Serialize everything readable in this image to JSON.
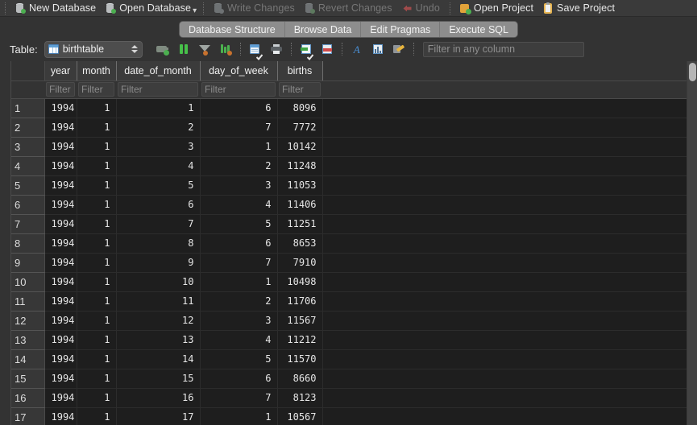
{
  "toolbar": {
    "buttons": [
      {
        "label": "New Database",
        "icon": "database-new-icon",
        "enabled": true,
        "badge": "#4caf50"
      },
      {
        "label": "Open Database",
        "icon": "database-open-icon",
        "enabled": true,
        "badge": "#4caf50",
        "has_dropdown": true
      },
      {
        "label": "Write Changes",
        "icon": "database-write-icon",
        "enabled": false,
        "badge": "#6e7274"
      },
      {
        "label": "Revert Changes",
        "icon": "database-revert-icon",
        "enabled": false,
        "badge": "#5d7a5f"
      },
      {
        "label": "Undo",
        "icon": "undo-arrow-icon",
        "enabled": false,
        "badge": "#a04b4b"
      },
      {
        "label": "Open Project",
        "icon": "project-open-icon",
        "enabled": true,
        "badge": "#4caf50"
      },
      {
        "label": "Save Project",
        "icon": "project-save-icon",
        "enabled": true,
        "badge": ""
      }
    ]
  },
  "tabs": {
    "items": [
      {
        "label": "Database Structure",
        "active": false
      },
      {
        "label": "Browse Data",
        "active": true
      },
      {
        "label": "Edit Pragmas",
        "active": false
      },
      {
        "label": "Execute SQL",
        "active": false
      }
    ]
  },
  "table_bar": {
    "label": "Table:",
    "selected_table": "birthtable",
    "tool_icons": [
      "new-record-icon",
      "delete-record-icon",
      "filter-icon",
      "sort-icon",
      "print-preview-icon",
      "print-icon",
      "import-icon",
      "export-icon",
      "format-function-icon",
      "plot-icon",
      "edit-cell-icon"
    ],
    "filter_any_placeholder": "Filter in any column"
  },
  "grid": {
    "columns": [
      "year",
      "month",
      "date_of_month",
      "day_of_week",
      "births"
    ],
    "filter_placeholder": "Filter",
    "rows": [
      {
        "n": "1",
        "year": "1994",
        "month": "1",
        "date_of_month": "1",
        "day_of_week": "6",
        "births": "8096"
      },
      {
        "n": "2",
        "year": "1994",
        "month": "1",
        "date_of_month": "2",
        "day_of_week": "7",
        "births": "7772"
      },
      {
        "n": "3",
        "year": "1994",
        "month": "1",
        "date_of_month": "3",
        "day_of_week": "1",
        "births": "10142"
      },
      {
        "n": "4",
        "year": "1994",
        "month": "1",
        "date_of_month": "4",
        "day_of_week": "2",
        "births": "11248"
      },
      {
        "n": "5",
        "year": "1994",
        "month": "1",
        "date_of_month": "5",
        "day_of_week": "3",
        "births": "11053"
      },
      {
        "n": "6",
        "year": "1994",
        "month": "1",
        "date_of_month": "6",
        "day_of_week": "4",
        "births": "11406"
      },
      {
        "n": "7",
        "year": "1994",
        "month": "1",
        "date_of_month": "7",
        "day_of_week": "5",
        "births": "11251"
      },
      {
        "n": "8",
        "year": "1994",
        "month": "1",
        "date_of_month": "8",
        "day_of_week": "6",
        "births": "8653"
      },
      {
        "n": "9",
        "year": "1994",
        "month": "1",
        "date_of_month": "9",
        "day_of_week": "7",
        "births": "7910"
      },
      {
        "n": "10",
        "year": "1994",
        "month": "1",
        "date_of_month": "10",
        "day_of_week": "1",
        "births": "10498"
      },
      {
        "n": "11",
        "year": "1994",
        "month": "1",
        "date_of_month": "11",
        "day_of_week": "2",
        "births": "11706"
      },
      {
        "n": "12",
        "year": "1994",
        "month": "1",
        "date_of_month": "12",
        "day_of_week": "3",
        "births": "11567"
      },
      {
        "n": "13",
        "year": "1994",
        "month": "1",
        "date_of_month": "13",
        "day_of_week": "4",
        "births": "11212"
      },
      {
        "n": "14",
        "year": "1994",
        "month": "1",
        "date_of_month": "14",
        "day_of_week": "5",
        "births": "11570"
      },
      {
        "n": "15",
        "year": "1994",
        "month": "1",
        "date_of_month": "15",
        "day_of_week": "6",
        "births": "8660"
      },
      {
        "n": "16",
        "year": "1994",
        "month": "1",
        "date_of_month": "16",
        "day_of_week": "7",
        "births": "8123"
      },
      {
        "n": "17",
        "year": "1994",
        "month": "1",
        "date_of_month": "17",
        "day_of_week": "1",
        "births": "10567"
      }
    ]
  },
  "colors": {
    "toolbar_bg": "#3a3a3a",
    "panel_bg": "#333333",
    "grid_bg": "#1e1e1e",
    "tab_active": "#8d8d8d",
    "text": "#e8e8e8",
    "text_disabled": "#777777"
  }
}
